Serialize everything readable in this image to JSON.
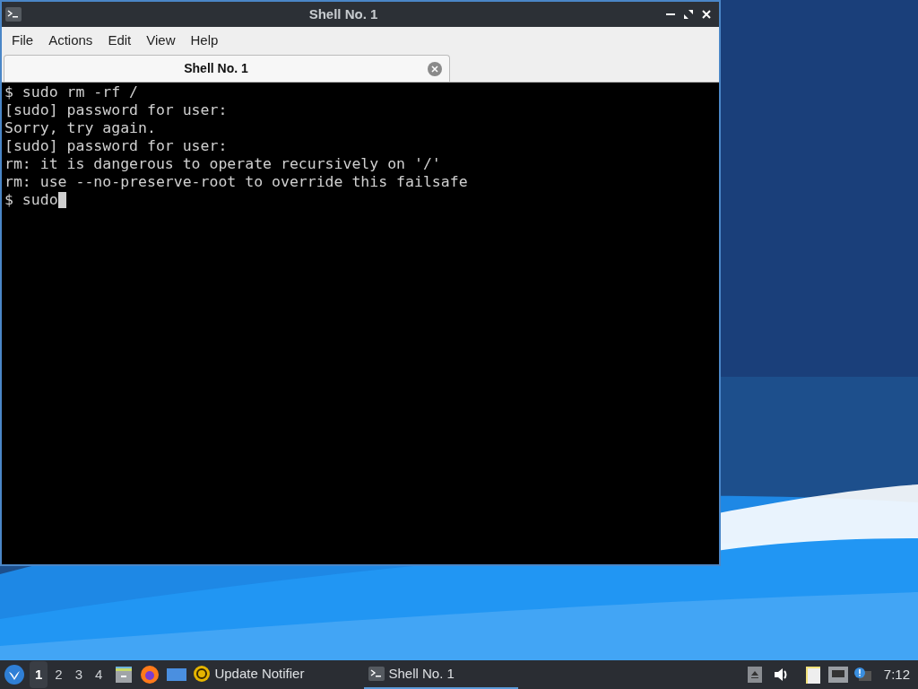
{
  "window": {
    "title": "Shell No. 1"
  },
  "menu": [
    "File",
    "Actions",
    "Edit",
    "View",
    "Help"
  ],
  "tabs": [
    {
      "label": "Shell No. 1",
      "selected": true
    }
  ],
  "terminal": {
    "lines": [
      "$ sudo rm -rf /",
      "[sudo] password for user:",
      "Sorry, try again.",
      "[sudo] password for user:",
      "rm: it is dangerous to operate recursively on '/'",
      "rm: use --no-preserve-root to override this failsafe",
      "$ sudo"
    ],
    "cursor": true
  },
  "taskbar": {
    "workspaces": [
      {
        "label": "1",
        "selected": true
      },
      {
        "label": "2",
        "selected": false
      },
      {
        "label": "3",
        "selected": false
      },
      {
        "label": "4",
        "selected": false
      }
    ],
    "tasks": [
      {
        "label": "Update Notifier",
        "kind": "notifier",
        "selected": false
      },
      {
        "label": "Shell No. 1",
        "kind": "terminal",
        "selected": true
      }
    ],
    "clock": "7:12"
  }
}
